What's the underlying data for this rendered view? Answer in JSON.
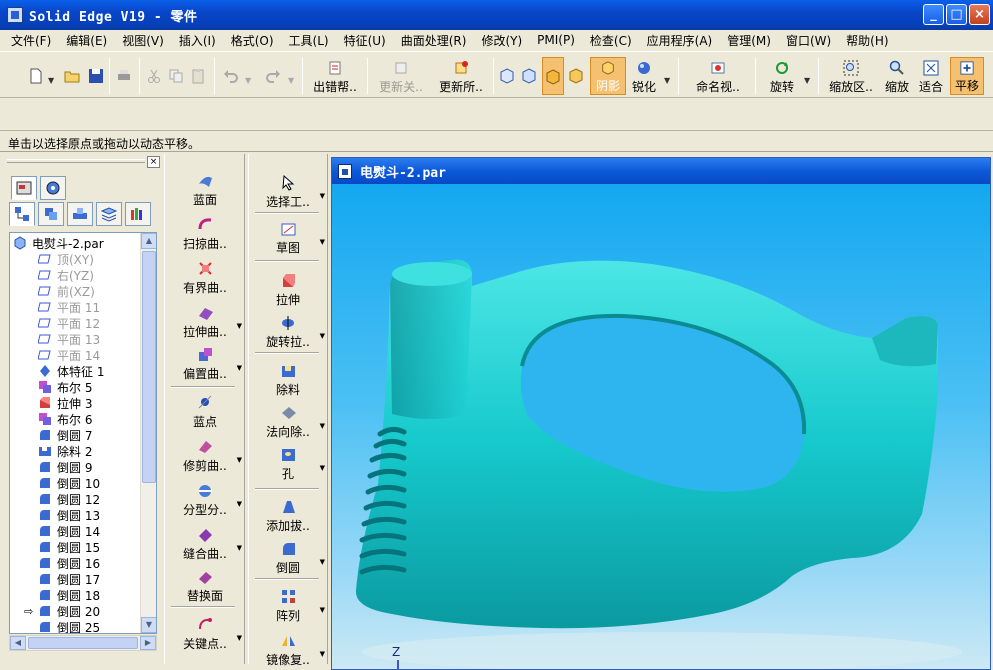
{
  "window": {
    "title": "Solid Edge V19 - 零件"
  },
  "menu": [
    "文件(F)",
    "编辑(E)",
    "视图(V)",
    "插入(I)",
    "格式(O)",
    "工具(L)",
    "特征(U)",
    "曲面处理(R)",
    "修改(Y)",
    "PMI(P)",
    "检查(C)",
    "应用程序(A)",
    "管理(M)",
    "窗口(W)",
    "帮助(H)"
  ],
  "toolbar": {
    "error_helper": "出错帮..",
    "update_related": "更新关..",
    "update_all": "更新所..",
    "shaded": "阴影",
    "sharpen": "锐化",
    "named_view": "命名视..",
    "rotate": "旋转",
    "zoom_area": "缩放区..",
    "zoom": "缩放",
    "fit": "适合",
    "pan": "平移"
  },
  "status": {
    "prompt": "单击以选择原点或拖动以动态平移。"
  },
  "tree": {
    "root": "电熨斗-2.par",
    "items": [
      "顶(XY)",
      "右(YZ)",
      "前(XZ)",
      "平面 11",
      "平面 12",
      "平面 13",
      "平面 14",
      "体特征 1",
      "布尔 5",
      "拉伸 3",
      "布尔 6",
      "倒圆 7",
      "除料 2",
      "倒圆 9",
      "倒圆 10",
      "倒圆 12",
      "倒圆 13",
      "倒圆 14",
      "倒圆 15",
      "倒圆 16",
      "倒圆 17",
      "倒圆 18",
      "倒圆 20",
      "倒圆 25"
    ]
  },
  "surface_tools": [
    "蓝面",
    "扫掠曲..",
    "有界曲..",
    "拉伸曲..",
    "偏置曲..",
    "蓝点",
    "修剪曲..",
    "分型分..",
    "缝合曲..",
    "替换面",
    "关键点.."
  ],
  "feature_tools": [
    "选择工..",
    "草图",
    "拉伸",
    "旋转拉..",
    "除料",
    "法向除..",
    "孔",
    "添加拔..",
    "倒圆",
    "阵列",
    "镜像复.."
  ],
  "view": {
    "doc_title": "电熨斗-2.par",
    "axis_label": "Z"
  },
  "colors": {
    "model": "#16c9cc",
    "background_top": "#14a8f0",
    "background_bottom": "#cde9f4",
    "title_blue": "#0a5fe8"
  }
}
